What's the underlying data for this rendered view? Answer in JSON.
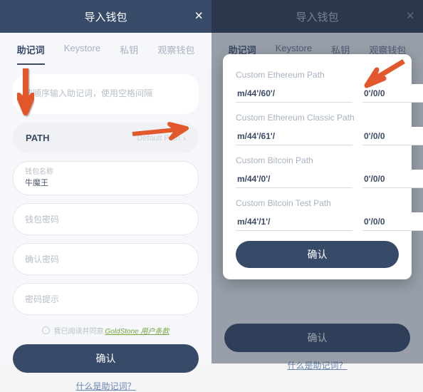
{
  "header": {
    "title": "导入钱包",
    "close": "×"
  },
  "tabs": [
    "助记词",
    "Keystore",
    "私钥",
    "观察钱包"
  ],
  "left": {
    "mnemonic_placeholder": "按顺序输入助记词，使用空格间隔",
    "path_label": "PATH",
    "path_value": "Default Path",
    "name_label": "钱包名称",
    "name_value": "牛魔王",
    "pwd_label": "钱包密码",
    "pwd2_label": "确认密码",
    "hint_label": "密码提示",
    "agree_text": "我已阅读并同意",
    "terms_text": "GoldStone 用户条款",
    "confirm": "确认",
    "footer": "什么是助记词？"
  },
  "modal": {
    "paths": [
      {
        "heading": "Custom Ethereum Path",
        "prefix": "m/44'/60'/",
        "suffix": "0'/0/0"
      },
      {
        "heading": "Custom Ethereum Classic Path",
        "prefix": "m/44'/61'/",
        "suffix": "0'/0/0"
      },
      {
        "heading": "Custom Bitcoin Path",
        "prefix": "m/44'/0'/",
        "suffix": "0'/0/0"
      },
      {
        "heading": "Custom Bitcoin Test Path",
        "prefix": "m/44'/1'/",
        "suffix": "0'/0/0"
      }
    ],
    "confirm": "确认"
  },
  "right": {
    "confirm": "确认",
    "footer": "什么是助记词？"
  },
  "colors": {
    "brand": "#374a68",
    "accent_arrow": "#e2572b"
  }
}
